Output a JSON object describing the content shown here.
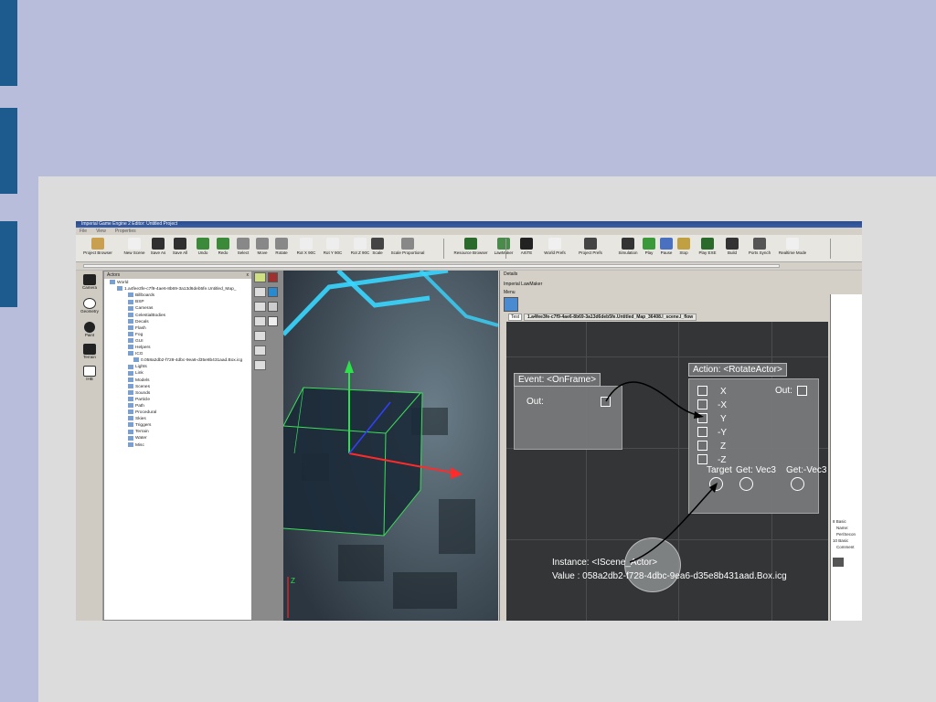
{
  "window": {
    "title": "Imperial Game Engine 2 Editor: Untitled Project",
    "menu": [
      "File",
      "View",
      "Properties"
    ]
  },
  "toolbar": {
    "items": [
      {
        "label": "Project Browser",
        "icon": "folder-icon"
      },
      {
        "label": "New Scene",
        "icon": "new-document-icon"
      },
      {
        "label": "Save As",
        "icon": "save-as-icon"
      },
      {
        "label": "Save All",
        "icon": "save-all-icon"
      },
      {
        "label": "Undo",
        "icon": "undo-icon"
      },
      {
        "label": "Redo",
        "icon": "redo-icon"
      },
      {
        "label": "Select",
        "icon": "select-icon"
      },
      {
        "label": "Move",
        "icon": "move-icon"
      },
      {
        "label": "Rotate",
        "icon": "rotate-icon"
      },
      {
        "label": "Rot X 90C",
        "icon": "rot-x-icon"
      },
      {
        "label": "Rot Y 90C",
        "icon": "rot-y-icon"
      },
      {
        "label": "Rot Z 90C",
        "icon": "rot-z-icon"
      },
      {
        "label": "Scale",
        "icon": "scale-icon"
      },
      {
        "label": "Scale Proportional",
        "icon": "scale-proportional-icon"
      },
      {
        "label": "Resource Browser",
        "icon": "resource-browser-icon"
      },
      {
        "label": "LawMaker",
        "icon": "lawmaker-icon"
      },
      {
        "label": "ArtiTE",
        "icon": "artite-icon"
      },
      {
        "label": "World Prefs",
        "icon": "world-globe-icon"
      },
      {
        "label": "Project Prefs",
        "icon": "project-prefs-icon"
      },
      {
        "label": "Simulation",
        "icon": "simulation-gear-icon"
      },
      {
        "label": "Play",
        "icon": "play-icon"
      },
      {
        "label": "Pause",
        "icon": "pause-icon"
      },
      {
        "label": "Stop",
        "icon": "stop-icon"
      },
      {
        "label": "Play EXE",
        "icon": "play-exe-icon"
      },
      {
        "label": "Build",
        "icon": "build-icon"
      },
      {
        "label": "Ports Synch",
        "icon": "ports-synch-icon"
      },
      {
        "label": "Realtime Mode",
        "icon": "realtime-clock-icon"
      }
    ]
  },
  "left_tools": [
    {
      "label": "Camera"
    },
    {
      "label": "Geometry"
    },
    {
      "label": "Paint"
    },
    {
      "label": "Terrain"
    },
    {
      "label": "IHB"
    }
  ],
  "actors": {
    "title": "Actors",
    "close": "x",
    "items": [
      "World",
      "1.a4fee3fe-c7f9-4ae6-8b69-3a13d6deb5fe.Untitled_Map_",
      "Billboards",
      "BSP",
      "Cameras",
      "CelestialBodies",
      "Decals",
      "Flash",
      "Fog",
      "GUI",
      "Helpers",
      "ICG",
      "0.058a2db2-f728-4dbc-9ea6-d35e8b431aad.Box.icg",
      "Lights",
      "Link",
      "Models",
      "Scenes",
      "Sounds",
      "Particle",
      "Path",
      "Procedural",
      "Skies",
      "Triggers",
      "Terrain",
      "Water",
      "Misc"
    ]
  },
  "details": {
    "title": "Details",
    "subtitle": "Imperial LawMaker",
    "menu": "Menu",
    "tab_test": "Test",
    "tab_file": "1.a4fee3fe-c7f9-4ae6-8b69-3a13d6deb5fe.Untitled_Map_36408.l_scene.l_flow"
  },
  "graph": {
    "event_node": {
      "title": "Event: <OnFrame>",
      "out": "Out:"
    },
    "action_node": {
      "title": "Action: <RotateActor>",
      "out": "Out:",
      "axes": [
        "X",
        "-X",
        "Y",
        "-Y",
        "Z",
        "-Z"
      ],
      "ports": [
        "Target",
        "Get: Vec3",
        "Get:-Vec3"
      ]
    },
    "instance_node": {
      "instance": "Instance: <IScene_Actor>",
      "value": "Value : 058a2db2-f728-4dbc-9ea6-d35e8b431aad.Box.icg"
    }
  },
  "right_panel": {
    "section_basic": "8 Basic",
    "name_label": "Name:",
    "per_second": "Per/Secon",
    "section2": "10 Basic",
    "comment": "Comment"
  },
  "colors": {
    "slide_bg": "#b8bddb",
    "slide_panel": "#dcdcdc",
    "accent_tab": "#1d5a8e",
    "graph_bg": "#333536",
    "node": "#77797a",
    "glow": "#38d6ff"
  }
}
